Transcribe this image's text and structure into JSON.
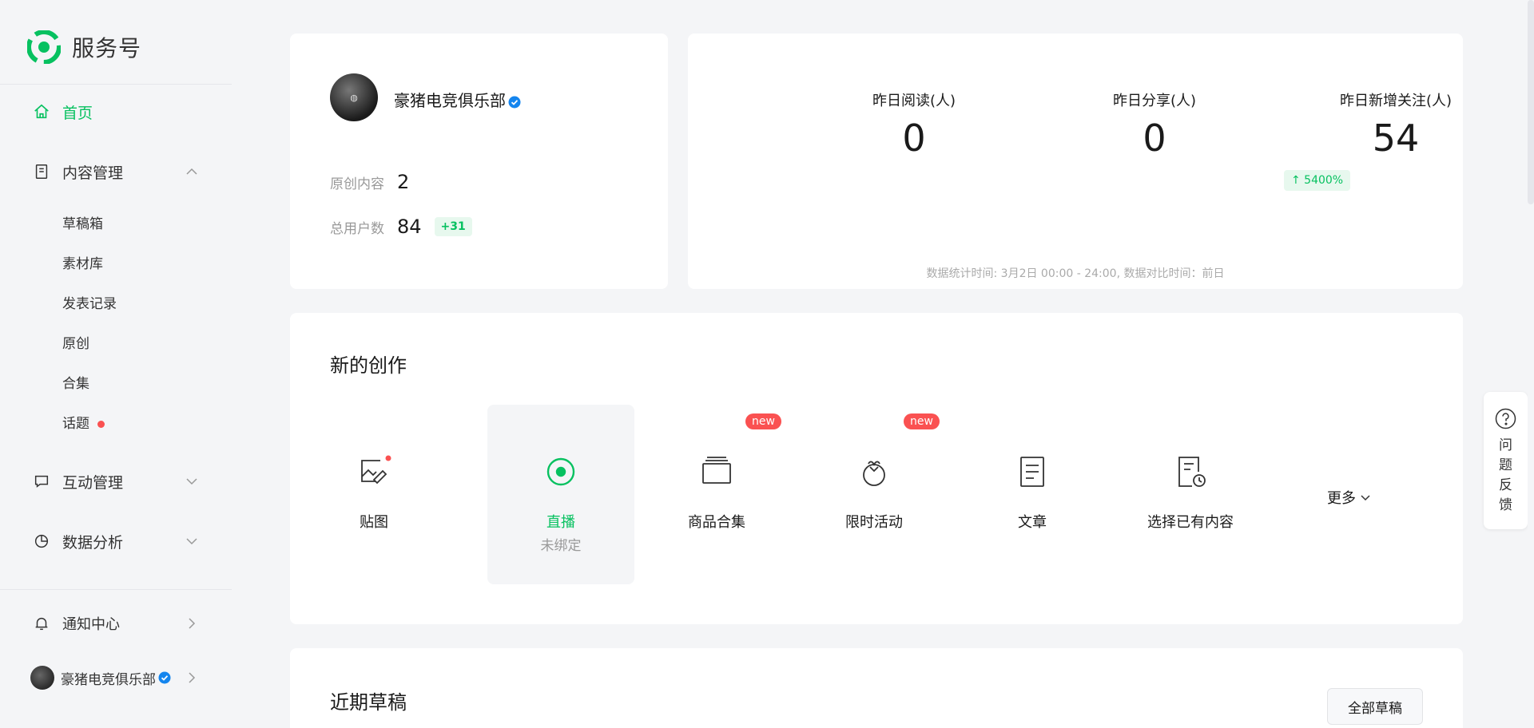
{
  "sidebar": {
    "logo_text": "服务号",
    "nav": {
      "home": "首页",
      "content": "内容管理",
      "interaction": "互动管理",
      "analytics": "数据分析",
      "notifications": "通知中心"
    },
    "content_sub": [
      "草稿箱",
      "素材库",
      "发表记录",
      "原创",
      "合集",
      "话题"
    ],
    "account_name": "豪猪电竞俱乐部"
  },
  "account_card": {
    "name": "豪猪电竞俱乐部",
    "original_label": "原创内容",
    "original_value": "2",
    "users_label": "总用户数",
    "users_value": "84",
    "users_delta": "+31"
  },
  "metrics": [
    {
      "label": "昨日阅读(人)",
      "value": "0"
    },
    {
      "label": "昨日分享(人)",
      "value": "0"
    },
    {
      "label": "昨日新增关注(人)",
      "value": "54",
      "badge": "↑ 5400%"
    }
  ],
  "metrics_footnote": "数据统计时间: 3月2日 00:00 - 24:00, 数据对比时间：前日",
  "creation": {
    "title": "新的创作",
    "tools": [
      {
        "label": "贴图",
        "icon": "image-edit-icon"
      },
      {
        "label": "直播",
        "sub": "未绑定",
        "icon": "live-icon"
      },
      {
        "label": "商品合集",
        "badge": "new",
        "icon": "collection-icon"
      },
      {
        "label": "限时活动",
        "badge": "new",
        "icon": "activity-icon"
      },
      {
        "label": "文章",
        "icon": "article-icon"
      },
      {
        "label": "选择已有内容",
        "icon": "history-content-icon"
      }
    ],
    "more": "更多"
  },
  "drafts": {
    "title": "近期草稿",
    "all_button": "全部草稿"
  },
  "feedback": "问题反馈",
  "colors": {
    "accent": "#07c160",
    "alert": "#fa5151",
    "verified": "#1485ee"
  }
}
